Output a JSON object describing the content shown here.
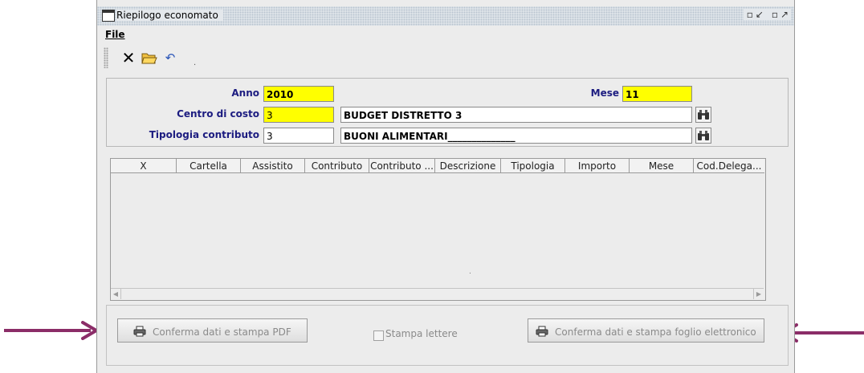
{
  "window": {
    "title": "Riepilogo economato",
    "controls": "▫↙ ▫↗"
  },
  "menu": {
    "file_label": "File"
  },
  "toolbar": {
    "close_icon": "close-icon",
    "open_icon": "open-folder-icon",
    "undo_icon": "undo-icon",
    "glyph_close": "✕",
    "glyph_open": "📂",
    "glyph_undo": "↶"
  },
  "form": {
    "anno_label": "Anno",
    "anno_value": "2010",
    "mese_label": "Mese",
    "mese_value": "11",
    "centro_label": "Centro di costo",
    "centro_code": "3",
    "centro_desc": "BUDGET DISTRETTO 3",
    "tipologia_label": "Tipologia contributo",
    "tipologia_code": "3",
    "tipologia_desc": "BUONI ALIMENTARI______________",
    "binoculars_glyph": "◉◉"
  },
  "table": {
    "columns": [
      "X",
      "Cartella",
      "Assistito",
      "Contributo",
      "Contributo ...",
      "Descrizione",
      "Tipologia",
      "Importo",
      "Mese",
      "Cod.Delega..."
    ],
    "rows": []
  },
  "actions": {
    "confirm_pdf_label": "Conferma dati e stampa PDF",
    "print_letters_label": "Stampa lettere",
    "confirm_spreadsheet_label": "Conferma dati e stampa foglio elettronico",
    "printer_glyph": "🖶"
  },
  "colors": {
    "field_highlight": "#ffff00",
    "label_text": "#1c1c80",
    "annotation_arrow": "#8b2d68"
  }
}
